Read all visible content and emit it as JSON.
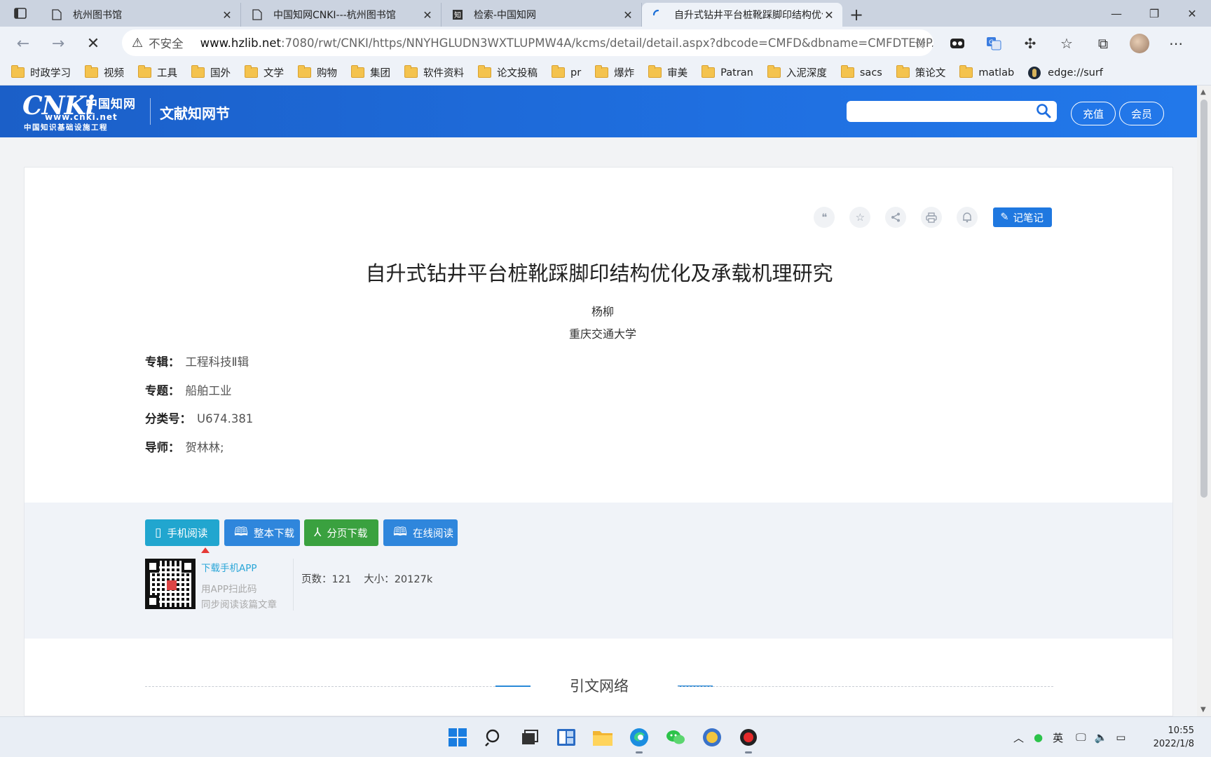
{
  "browser": {
    "tabs": [
      {
        "title": "杭州图书馆",
        "favicon": "page-icon",
        "active": false
      },
      {
        "title": "中国知网CNKI---杭州图书馆",
        "favicon": "page-icon",
        "active": false
      },
      {
        "title": "检索-中国知网",
        "favicon": "cnki-favicon",
        "active": false
      },
      {
        "title": "自升式钻井平台桩靴踩脚印结构优化及承载机理研究",
        "favicon": "loading-spinner-icon",
        "active": true
      }
    ],
    "address": {
      "security_label": "不安全",
      "url_host": "www.hzlib.net",
      "url_path": ":7080/rwt/CNKI/https/NNYHGLUDN3WXTLUPMW4A/kcms/detail/detail.aspx?dbcode=CMFD&dbname=CMFDTEMP..."
    },
    "bookmarks": [
      "时政学习",
      "视频",
      "工具",
      "国外",
      "文学",
      "购物",
      "集团",
      "软件资料",
      "论文投稿",
      "pr",
      "爆炸",
      "审美",
      "Patran",
      "入泥深度",
      "sacs",
      "策论文",
      "matlab"
    ],
    "bookmark_special": "edge://surf"
  },
  "site": {
    "logo_big": "CNKi",
    "logo_cn": "中国知网",
    "logo_url": "www.cnki.net",
    "logo_sub": "中国知识基础设施工程",
    "name": "文献知网节",
    "search_placeholder": "",
    "recharge_label": "充值",
    "member_label": "会员"
  },
  "paper": {
    "note_label": "记笔记",
    "title": "自升式钻井平台桩靴踩脚印结构优化及承载机理研究",
    "author": "杨柳",
    "school": "重庆交通大学",
    "meta": [
      {
        "label": "专辑：",
        "value": "工程科技Ⅱ辑"
      },
      {
        "label": "专题：",
        "value": "船舶工业"
      },
      {
        "label": "分类号：",
        "value": "U674.381"
      },
      {
        "label": "导师：",
        "value": "贺林林;"
      }
    ],
    "downloads": [
      {
        "label": "手机阅读",
        "color": "#21a6cf",
        "icon": "mobile-icon"
      },
      {
        "label": "整本下载",
        "color": "#2f86dc",
        "icon": "book-icon"
      },
      {
        "label": "分页下载",
        "color": "#3aa13f",
        "icon": "pdf-icon"
      },
      {
        "label": "在线阅读",
        "color": "#2f86dc",
        "icon": "book-icon"
      }
    ],
    "app_link": "下载手机APP",
    "app_hint1": "用APP扫此码",
    "app_hint2": "同步阅读该篇文章",
    "pages_label": "页数：",
    "pages_value": "121",
    "size_label": "大小：",
    "size_value": "20127k",
    "section_title": "引文网络"
  },
  "taskbar": {
    "apps": [
      "windows-start-icon",
      "search-icon",
      "task-view-icon",
      "widgets-icon",
      "file-explorer-icon",
      "edge-icon",
      "wechat-icon",
      "app-icon",
      "recorder-icon"
    ],
    "ime": "英",
    "time": "10:55",
    "date": "2022/1/8"
  }
}
